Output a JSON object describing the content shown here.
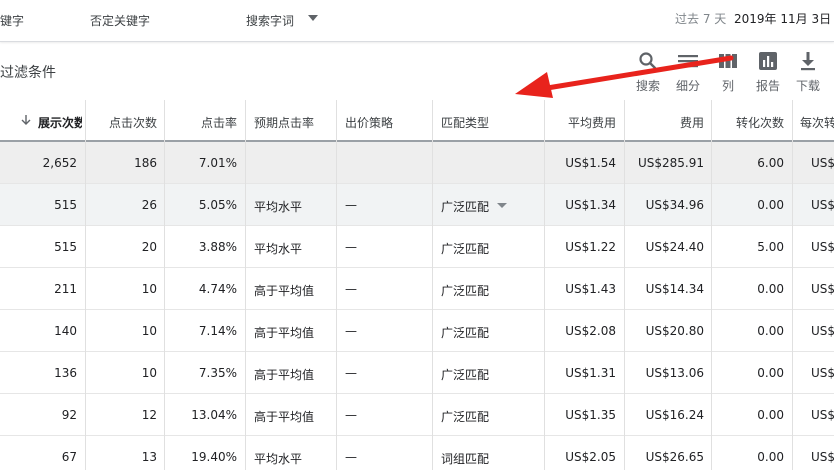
{
  "topbar": {
    "tab_keywords": "键字",
    "tab_negative": "否定关键字",
    "tab_search_terms": "搜索字词",
    "range_label": "过去 7 天",
    "range_value": "2019年 11月 3日"
  },
  "filter": {
    "label": "过滤条件"
  },
  "toolbar": {
    "search": "搜索",
    "segment": "细分",
    "columns": "列",
    "reports": "报告",
    "download": "下载"
  },
  "table": {
    "headers": {
      "impressions": "展示次数",
      "clicks": "点击次数",
      "ctr": "点击率",
      "expected_ctr": "预期点击率",
      "bid_strategy": "出价策略",
      "match_type": "匹配类型",
      "avg_cpc": "平均费用",
      "cost": "费用",
      "conversions": "转化次数",
      "cost_per_conv": "每次转化费用"
    },
    "rows": [
      {
        "impressions": "2,652",
        "clicks": "186",
        "ctr": "7.01%",
        "expected_ctr": "",
        "bid_strategy": "",
        "match_type": "",
        "avg_cpc": "US$1.54",
        "cost": "US$285.91",
        "conversions": "6.00",
        "cost_per_conv": "US$"
      },
      {
        "impressions": "515",
        "clicks": "26",
        "ctr": "5.05%",
        "expected_ctr": "平均水平",
        "bid_strategy": "—",
        "match_type": "广泛匹配",
        "avg_cpc": "US$1.34",
        "cost": "US$34.96",
        "conversions": "0.00",
        "cost_per_conv": "US$"
      },
      {
        "impressions": "515",
        "clicks": "20",
        "ctr": "3.88%",
        "expected_ctr": "平均水平",
        "bid_strategy": "—",
        "match_type": "广泛匹配",
        "avg_cpc": "US$1.22",
        "cost": "US$24.40",
        "conversions": "5.00",
        "cost_per_conv": "US$"
      },
      {
        "impressions": "211",
        "clicks": "10",
        "ctr": "4.74%",
        "expected_ctr": "高于平均值",
        "bid_strategy": "—",
        "match_type": "广泛匹配",
        "avg_cpc": "US$1.43",
        "cost": "US$14.34",
        "conversions": "0.00",
        "cost_per_conv": "US$"
      },
      {
        "impressions": "140",
        "clicks": "10",
        "ctr": "7.14%",
        "expected_ctr": "高于平均值",
        "bid_strategy": "—",
        "match_type": "广泛匹配",
        "avg_cpc": "US$2.08",
        "cost": "US$20.80",
        "conversions": "0.00",
        "cost_per_conv": "US$"
      },
      {
        "impressions": "136",
        "clicks": "10",
        "ctr": "7.35%",
        "expected_ctr": "高于平均值",
        "bid_strategy": "—",
        "match_type": "广泛匹配",
        "avg_cpc": "US$1.31",
        "cost": "US$13.06",
        "conversions": "0.00",
        "cost_per_conv": "US$"
      },
      {
        "impressions": "92",
        "clicks": "12",
        "ctr": "13.04%",
        "expected_ctr": "高于平均值",
        "bid_strategy": "—",
        "match_type": "广泛匹配",
        "avg_cpc": "US$1.35",
        "cost": "US$16.24",
        "conversions": "0.00",
        "cost_per_conv": "US$"
      },
      {
        "impressions": "67",
        "clicks": "13",
        "ctr": "19.40%",
        "expected_ctr": "平均水平",
        "bid_strategy": "—",
        "match_type": "词组匹配",
        "avg_cpc": "US$2.05",
        "cost": "US$26.65",
        "conversions": "0.00",
        "cost_per_conv": "US$"
      }
    ]
  },
  "colors": {
    "total_row_bg": "#eeeeee",
    "hover_row_bg": "#f1f3f4",
    "annotation_arrow": "#e8231c"
  },
  "icons": {
    "search": "search-icon",
    "segment": "segment-icon",
    "columns": "columns-icon",
    "reports": "bar-chart-icon",
    "download": "download-icon",
    "sort": "arrow-down-icon",
    "dropdown": "caret-down-icon"
  }
}
